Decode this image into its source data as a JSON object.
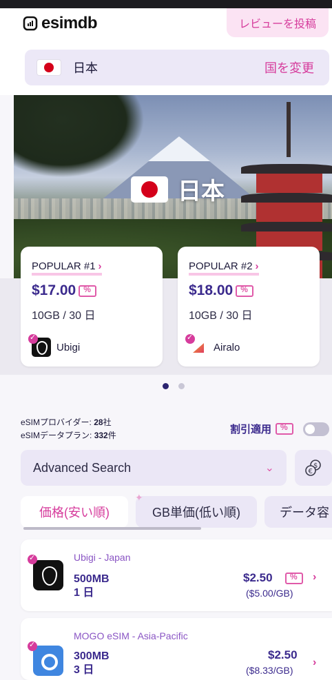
{
  "header": {
    "logo_text": "esimdb",
    "review_button": "レビューを投稿"
  },
  "country_selector": {
    "country": "日本",
    "change_label": "国を変更"
  },
  "hero": {
    "country": "日本"
  },
  "popular": [
    {
      "label": "POPULAR #1",
      "price": "$17.00",
      "plan": "10GB / 30 日",
      "provider": "Ubigi"
    },
    {
      "label": "POPULAR #2",
      "price": "$18.00",
      "plan": "10GB / 30 日",
      "provider": "Airalo"
    }
  ],
  "carousel": {
    "pages": 2,
    "active": 1
  },
  "stats": {
    "providers_label": "eSIMプロバイダー: ",
    "providers_value": "28",
    "providers_unit": "社",
    "plans_label": "eSIMデータプラン: ",
    "plans_value": "332",
    "plans_unit": "件"
  },
  "discount_toggle": {
    "label": "割引適用",
    "on": false
  },
  "search": {
    "label": "Advanced Search"
  },
  "sort_tabs": [
    "価格(安い順)",
    "GB単価(低い順)",
    "データ容"
  ],
  "plans": [
    {
      "provider": "Ubigi - Japan",
      "data": "500MB",
      "duration": "1 日",
      "price": "$2.50",
      "per_gb": "($5.00/GB)"
    },
    {
      "provider": "MOGO eSIM - Asia-Pacific",
      "data": "300MB",
      "duration": "3 日",
      "price": "$2.50",
      "per_gb": "($8.33/GB)"
    }
  ],
  "icons": {
    "logo": "esimdb-sim-icon",
    "discount": "ticket-percent-icon",
    "currency": "currency-exchange-icon",
    "chevron": "chevron-right-icon",
    "verified": "verified-badge-icon"
  },
  "colors": {
    "accent_pink": "#d63c9c",
    "brand_purple": "#3b2a8d",
    "pill_bg": "#ece8f7"
  }
}
